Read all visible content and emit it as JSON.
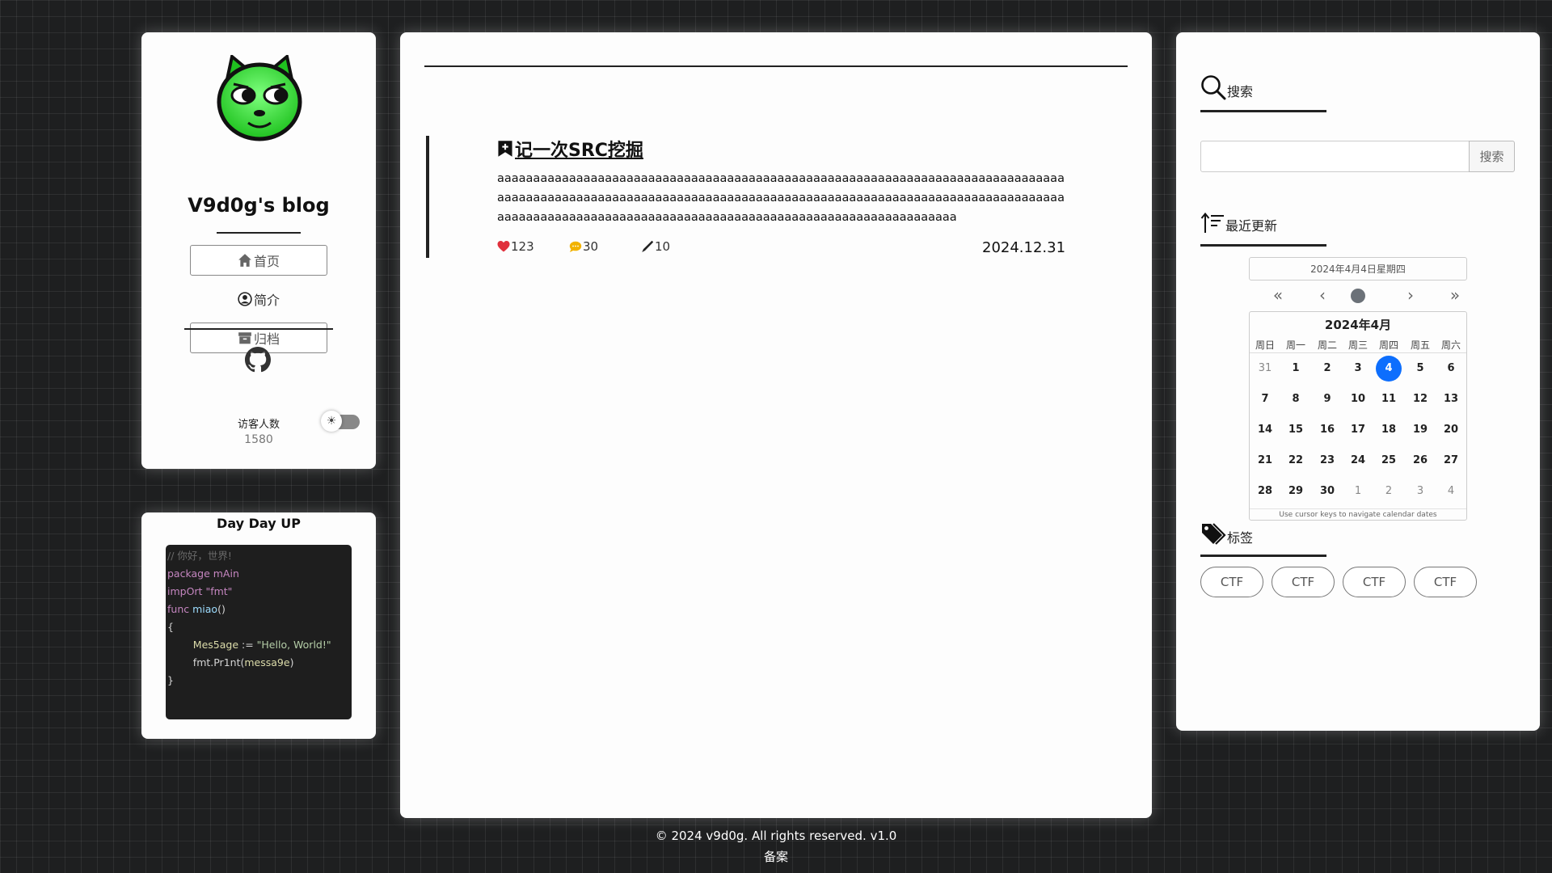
{
  "profile": {
    "blog_title": "V9d0g's blog",
    "nav": [
      {
        "label": "首页",
        "icon": "home-icon"
      },
      {
        "label": "简介",
        "icon": "user-circle-icon"
      },
      {
        "label": "归档",
        "icon": "archive-icon"
      }
    ],
    "visitors_label": "访客人数",
    "visitors_count": "1580",
    "theme_icon": "sun-icon"
  },
  "code_card": {
    "title": "Day Day UP",
    "lines": {
      "l1": "// 你好，世界!",
      "l2_kw": "package",
      "l2_rest": " mAin",
      "l3_kw": "impOrt",
      "l3_str": " \"fmt\"",
      "l4_kw": "func",
      "l4_fn": " miao",
      "l4_rest": "()",
      "l5": "{",
      "l6_var": "        Mes5age",
      "l6_op": " := ",
      "l6_str": "\"Hello, World!\"",
      "l7_a": "        fmt.Pr1nt(",
      "l7_b": "messa9e",
      "l7_c": ")",
      "l8": "}"
    }
  },
  "post": {
    "title": "记一次SRC挖掘",
    "excerpt": "aaaaaaaaaaaaaaaaaaaaaaaaaaaaaaaaaaaaaaaaaaaaaaaaaaaaaaaaaaaaaaaaaaaaaaaaaaaaaaaaaaaaaaaaaaaaaaaaaaaaaaaaaaaaaaaaaaaaaaaaaaaaaaaaaaaaaaaaaaaaaaaaaaaaaaaaaaaaaaaaaaaaaaaaaaaaaaaaaaaaaaaaaaaaaaaaaaaaaaaaaaaaaaaaaaaaaaaaaaaaaa",
    "likes": "123",
    "comments": "30",
    "edits": "10",
    "date": "2024.12.31"
  },
  "sidebar": {
    "search_heading": "搜索",
    "search_button": "搜索",
    "search_placeholder": "",
    "recent_heading": "最近更新",
    "tags_heading": "标签",
    "tags": [
      "CTF",
      "CTF",
      "CTF",
      "CTF"
    ]
  },
  "calendar": {
    "selected_text": "2024年4月4日星期四",
    "month_title": "2024年4月",
    "weekdays": [
      "周日",
      "周一",
      "周二",
      "周三",
      "周四",
      "周五",
      "周六"
    ],
    "weeks": [
      [
        "31",
        "1",
        "2",
        "3",
        "4",
        "5",
        "6"
      ],
      [
        "7",
        "8",
        "9",
        "10",
        "11",
        "12",
        "13"
      ],
      [
        "14",
        "15",
        "16",
        "17",
        "18",
        "19",
        "20"
      ],
      [
        "21",
        "22",
        "23",
        "24",
        "25",
        "26",
        "27"
      ],
      [
        "28",
        "29",
        "30",
        "1",
        "2",
        "3",
        "4"
      ]
    ],
    "selected_day": "4",
    "footer_hint": "Use cursor keys to navigate calendar dates"
  },
  "footer": {
    "copyright": "© 2024 v9d0g. All rights reserved. v1.0",
    "beian": "备案"
  }
}
